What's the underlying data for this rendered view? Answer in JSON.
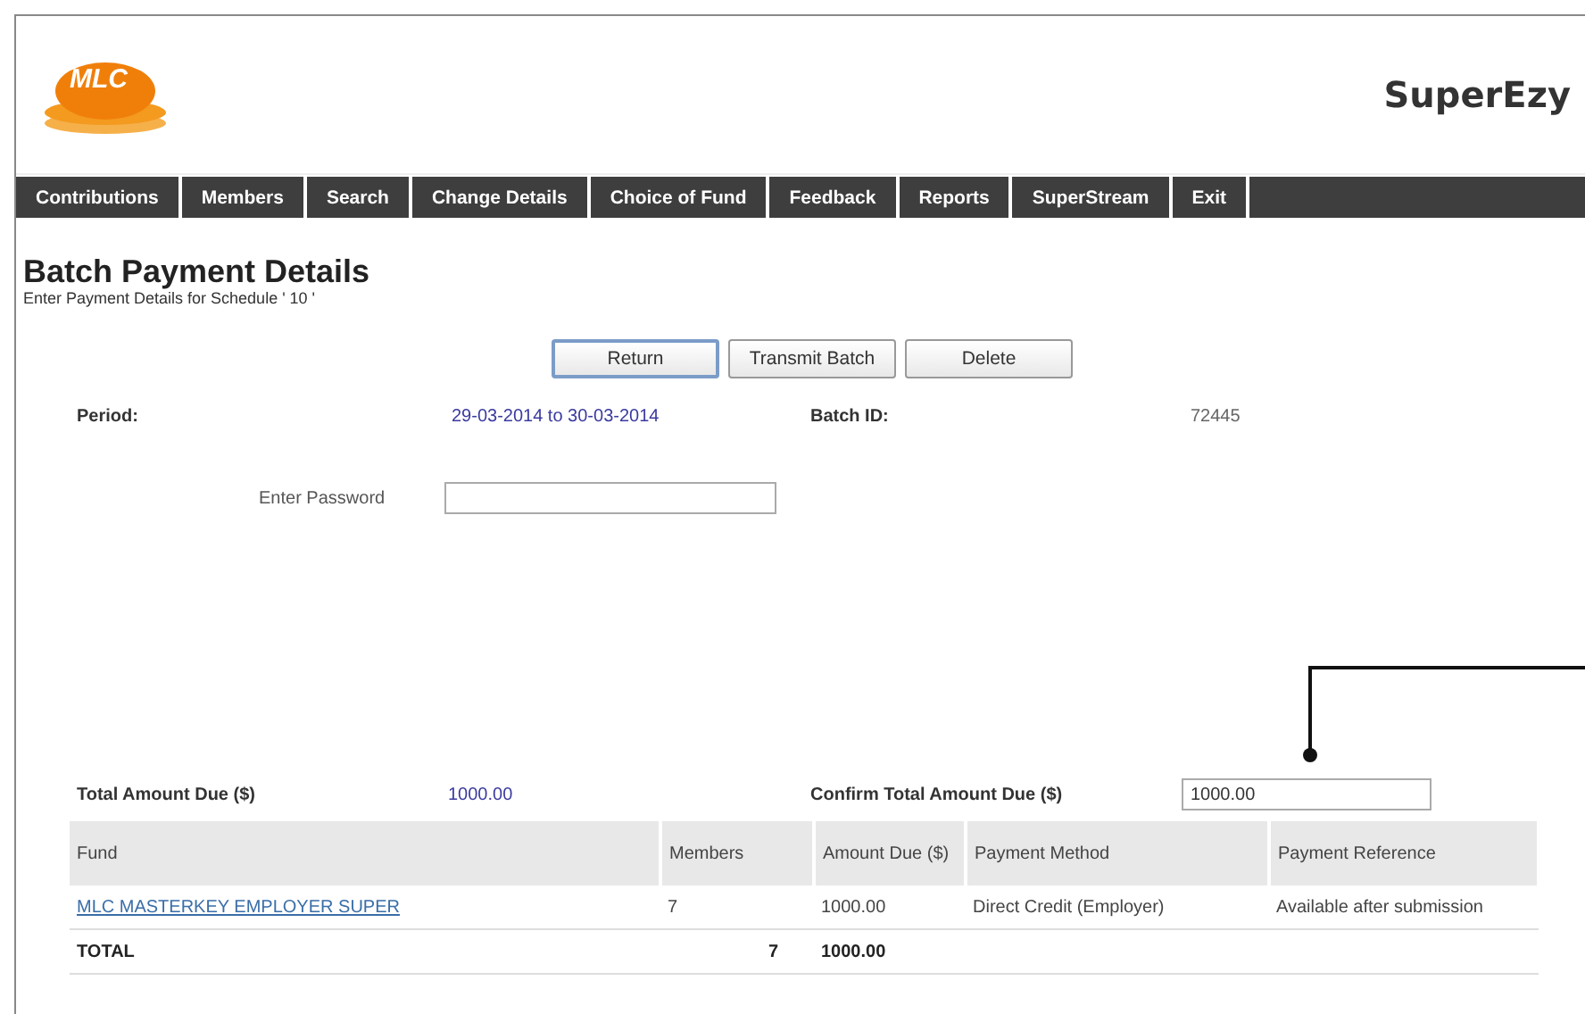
{
  "header": {
    "logo_text": "MLC",
    "product": "SuperEzy"
  },
  "nav": [
    "Contributions",
    "Members",
    "Search",
    "Change Details",
    "Choice of Fund",
    "Feedback",
    "Reports",
    "SuperStream",
    "Exit"
  ],
  "page": {
    "title": "Batch Payment Details",
    "subtitle": "Enter Payment Details for Schedule ' 10 '"
  },
  "buttons": [
    {
      "label": "Return",
      "selected": true
    },
    {
      "label": "Transmit Batch",
      "selected": false
    },
    {
      "label": "Delete",
      "selected": false
    }
  ],
  "info": {
    "period_label": "Period:",
    "period_value": "29-03-2014 to 30-03-2014",
    "batch_label": "Batch ID:",
    "batch_value": "72445"
  },
  "password": {
    "label": "Enter Password"
  },
  "totals": {
    "total_label": "Total Amount Due ($)",
    "total_value": "1000.00",
    "confirm_label": "Confirm Total Amount Due ($)",
    "confirm_value": "1000.00"
  },
  "table": {
    "columns": [
      "Fund",
      "Members",
      "Amount Due ($)",
      "Payment Method",
      "Payment Reference"
    ],
    "rows": [
      [
        "MLC MASTERKEY EMPLOYER SUPER",
        "7",
        "1000.00",
        "Direct Credit (Employer)",
        "Available after submission"
      ]
    ],
    "total": [
      "TOTAL",
      "7",
      "1000.00"
    ]
  }
}
